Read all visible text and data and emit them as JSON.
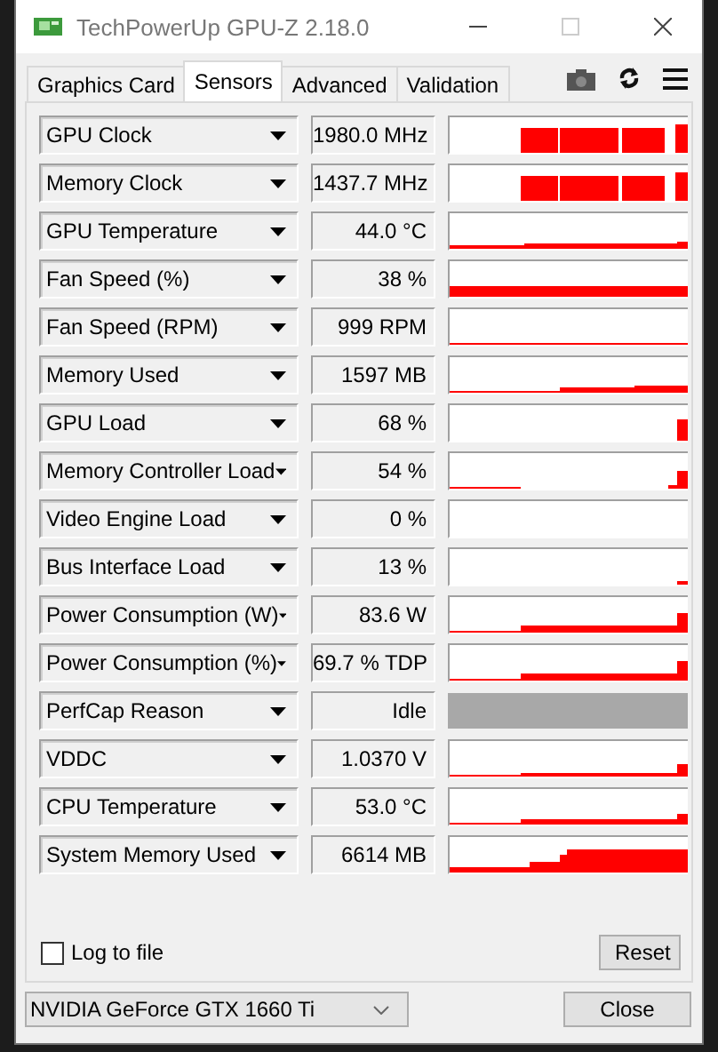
{
  "window": {
    "title": "TechPowerUp GPU-Z 2.18.0"
  },
  "tabs": [
    {
      "label": "Graphics Card",
      "selected": false
    },
    {
      "label": "Sensors",
      "selected": true
    },
    {
      "label": "Advanced",
      "selected": false
    },
    {
      "label": "Validation",
      "selected": false
    }
  ],
  "sensors": [
    {
      "name": "GPU Clock",
      "value": "1980.0 MHz",
      "kind": "graph"
    },
    {
      "name": "Memory Clock",
      "value": "1437.7 MHz",
      "kind": "graph"
    },
    {
      "name": "GPU Temperature",
      "value": "44.0 °C",
      "kind": "graph"
    },
    {
      "name": "Fan Speed (%)",
      "value": "38 %",
      "kind": "graph"
    },
    {
      "name": "Fan Speed (RPM)",
      "value": "999 RPM",
      "kind": "graph"
    },
    {
      "name": "Memory Used",
      "value": "1597 MB",
      "kind": "graph"
    },
    {
      "name": "GPU Load",
      "value": "68 %",
      "kind": "graph"
    },
    {
      "name": "Memory Controller Load",
      "value": "54 %",
      "kind": "graph"
    },
    {
      "name": "Video Engine Load",
      "value": "0 %",
      "kind": "graph"
    },
    {
      "name": "Bus Interface Load",
      "value": "13 %",
      "kind": "graph"
    },
    {
      "name": "Power Consumption (W)",
      "value": "83.6 W",
      "kind": "graph"
    },
    {
      "name": "Power Consumption (%)",
      "value": "69.7 % TDP",
      "kind": "graph"
    },
    {
      "name": "PerfCap Reason",
      "value": "Idle",
      "kind": "status"
    },
    {
      "name": "VDDC",
      "value": "1.0370 V",
      "kind": "graph"
    },
    {
      "name": "CPU Temperature",
      "value": "53.0 °C",
      "kind": "graph"
    },
    {
      "name": "System Memory Used",
      "value": "6614 MB",
      "kind": "graph"
    }
  ],
  "log_to_file": {
    "label": "Log to file",
    "checked": false
  },
  "reset_button": "Reset",
  "gpu_select": {
    "value": "NVIDIA GeForce GTX 1660 Ti"
  },
  "close_button": "Close"
}
